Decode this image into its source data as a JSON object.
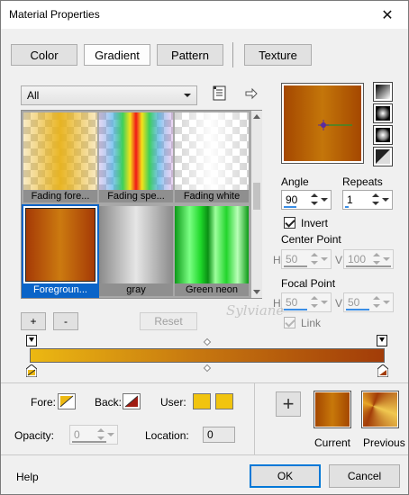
{
  "window": {
    "title": "Material Properties",
    "close_glyph": "✕"
  },
  "tabs": [
    {
      "label": "Color",
      "active": false
    },
    {
      "label": "Gradient",
      "active": true
    },
    {
      "label": "Pattern",
      "active": false
    },
    {
      "label": "Texture",
      "active": false
    }
  ],
  "category": {
    "selected": "All"
  },
  "gradients": [
    {
      "label": "Fading fore...",
      "selected": false
    },
    {
      "label": "Fading spe...",
      "selected": false
    },
    {
      "label": "Fading white",
      "selected": false
    },
    {
      "label": "Foregroun...",
      "selected": true
    },
    {
      "label": "gray",
      "selected": false
    },
    {
      "label": "Green neon",
      "selected": false
    }
  ],
  "list_buttons": {
    "add": "+",
    "remove": "-",
    "reset": "Reset"
  },
  "properties": {
    "angle_label": "Angle",
    "angle_value": "90",
    "repeats_label": "Repeats",
    "repeats_value": "1",
    "invert_label": "Invert",
    "invert_checked": true,
    "center_point_label": "Center Point",
    "center_h_label": "H",
    "center_h_value": "50",
    "center_v_label": "V",
    "center_v_value": "100",
    "focal_point_label": "Focal Point",
    "focal_h_label": "H",
    "focal_h_value": "50",
    "focal_v_label": "V",
    "focal_v_value": "50",
    "link_label": "Link",
    "link_checked": true
  },
  "editor": {
    "fore_label": "Fore:",
    "back_label": "Back:",
    "user_label": "User:",
    "opacity_label": "Opacity:",
    "opacity_value": "0",
    "location_label": "Location:",
    "location_value": "0",
    "colors": {
      "fore": "#ecb812",
      "back": "#a23c08",
      "user": "#f1c40f"
    }
  },
  "previews": {
    "add_glyph": "+",
    "current_label": "Current",
    "previous_label": "Previous"
  },
  "footer": {
    "help": "Help",
    "ok": "OK",
    "cancel": "Cancel"
  },
  "watermark": "Sylviane",
  "icons": [
    "close-icon",
    "dropdown-arrow-icon",
    "browse-list-icon",
    "arrow-right-icon",
    "linear-style-icon",
    "rectangular-style-icon",
    "sunburst-style-icon",
    "radial-style-icon",
    "plus-icon"
  ]
}
